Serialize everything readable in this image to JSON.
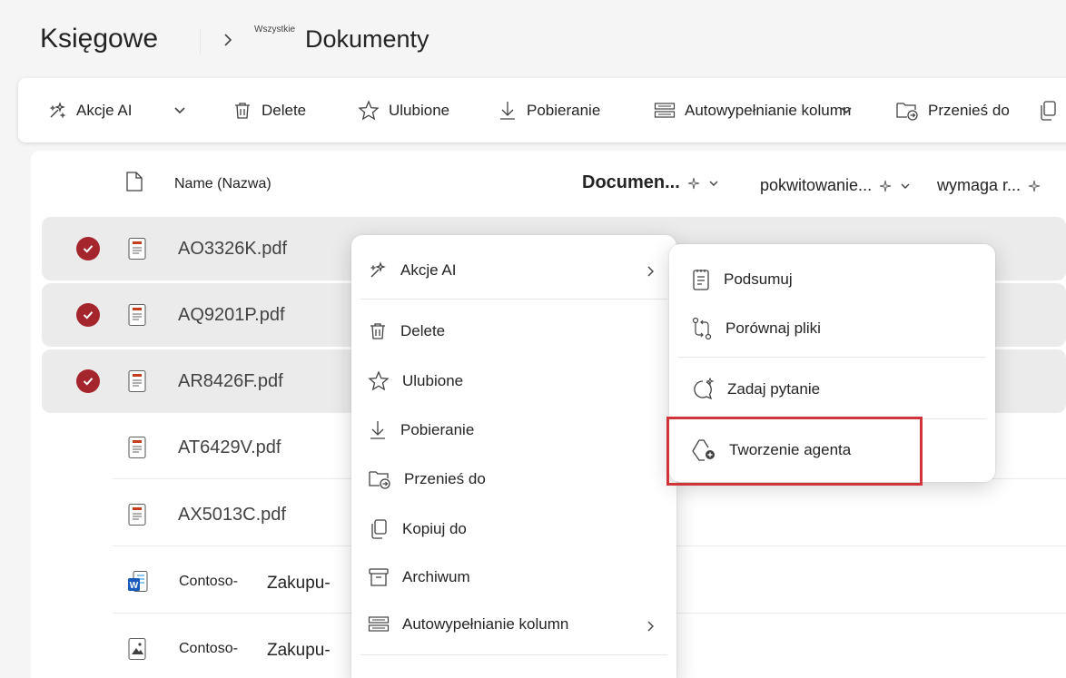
{
  "header": {
    "site_title": "Księgowe",
    "breadcrumb_all": "Wszystkie",
    "library_title": "Dokumenty"
  },
  "toolbar": {
    "ai_actions": "Akcje AI",
    "delete": "Delete",
    "favorite": "Ulubione",
    "download": "Pobieranie",
    "autofill": "Autowypełnianie kolumn",
    "move_to": "Przenieś do"
  },
  "columns": {
    "name": "Name (Nazwa)",
    "document": "Documen...",
    "receipt": "pokwitowanie...",
    "requires": "wymaga r..."
  },
  "files": [
    {
      "name": "AO3326K.pdf",
      "type": "pdf",
      "selected": true
    },
    {
      "name": "AQ9201P.pdf",
      "type": "pdf",
      "selected": true
    },
    {
      "name": "AR8426F.pdf",
      "type": "pdf",
      "selected": true
    },
    {
      "name": "AT6429V.pdf",
      "type": "pdf",
      "selected": false
    },
    {
      "name": "AX5013C.pdf",
      "type": "pdf",
      "selected": false
    },
    {
      "name_a": "Contoso-",
      "name_b": "Zakupu-",
      "type": "word",
      "selected": false
    },
    {
      "name_a": "Contoso-",
      "name_b": "Zakupu-",
      "type": "image",
      "selected": false
    }
  ],
  "context_menu": {
    "ai_actions": "Akcje AI",
    "delete": "Delete",
    "favorite": "Ulubione",
    "download": "Pobieranie",
    "move_to": "Przenieś do",
    "copy_to": "Kopiuj do",
    "archive": "Archiwum",
    "autofill": "Autowypełnianie kolumn"
  },
  "submenu": {
    "summarize": "Podsumuj",
    "compare": "Porównaj pliki",
    "ask": "Zadaj pytanie",
    "create_agent": "Tworzenie agenta"
  },
  "colors": {
    "check": "#a4262c",
    "highlight": "#d13438",
    "selected_row": "#ebebeb",
    "word": "#185abd"
  }
}
